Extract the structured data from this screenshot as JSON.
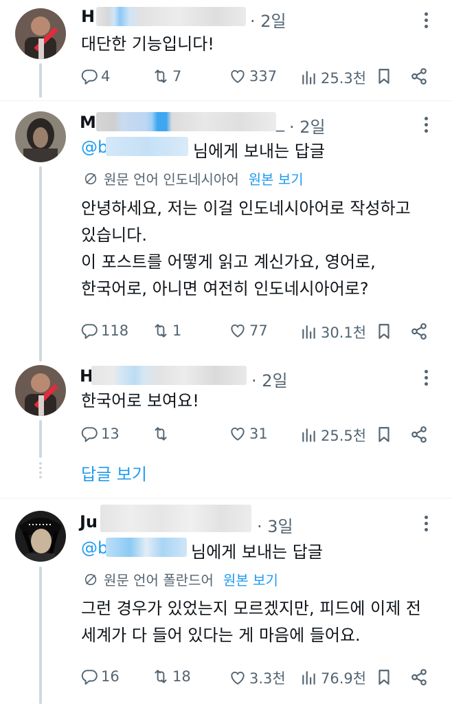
{
  "colors": {
    "accent": "#1d9bf0",
    "muted": "#536471",
    "text": "#0f1419"
  },
  "posts": [
    {
      "name_visible": "H",
      "time": "· 2일",
      "text": "대단한 기능입니다!",
      "replies": "4",
      "reposts": "7",
      "likes": "337",
      "views": "25.3천"
    },
    {
      "name_visible": "M",
      "handle_tail": "_",
      "time": "· 2일",
      "reply_to_handle": "@b",
      "reply_to_suffix": "님에게 보내는 답글",
      "translate_label": "원문 언어 인도네시아어",
      "translate_link": "원본 보기",
      "text": "안녕하세요, 저는 이걸 인도네시아어로 작성하고\n있습니다.\n이 포스트를 어떻게 읽고 계신가요, 영어로,\n한국어로, 아니면 여전히 인도네시아어로?",
      "replies": "118",
      "reposts": "1",
      "likes": "77",
      "views": "30.1천"
    },
    {
      "name_visible": "H",
      "time": "· 2일",
      "text": "한국어로 보여요!",
      "replies": "13",
      "reposts": "",
      "likes": "31",
      "views": "25.5천"
    },
    {
      "name_visible": "Ju",
      "time": "· 3일",
      "reply_to_handle": "@b",
      "reply_to_suffix": "님에게 보내는 답글",
      "translate_label": "원문 언어 폴란드어",
      "translate_link": "원본 보기",
      "text": "그런 경우가 있었는지 모르겠지만, 피드에 이제 전\n세계가 다 들어 있다는 게 마음에 들어요.",
      "replies": "16",
      "reposts": "18",
      "likes": "3.3천",
      "views": "76.9천"
    }
  ],
  "view_replies": "답글 보기"
}
